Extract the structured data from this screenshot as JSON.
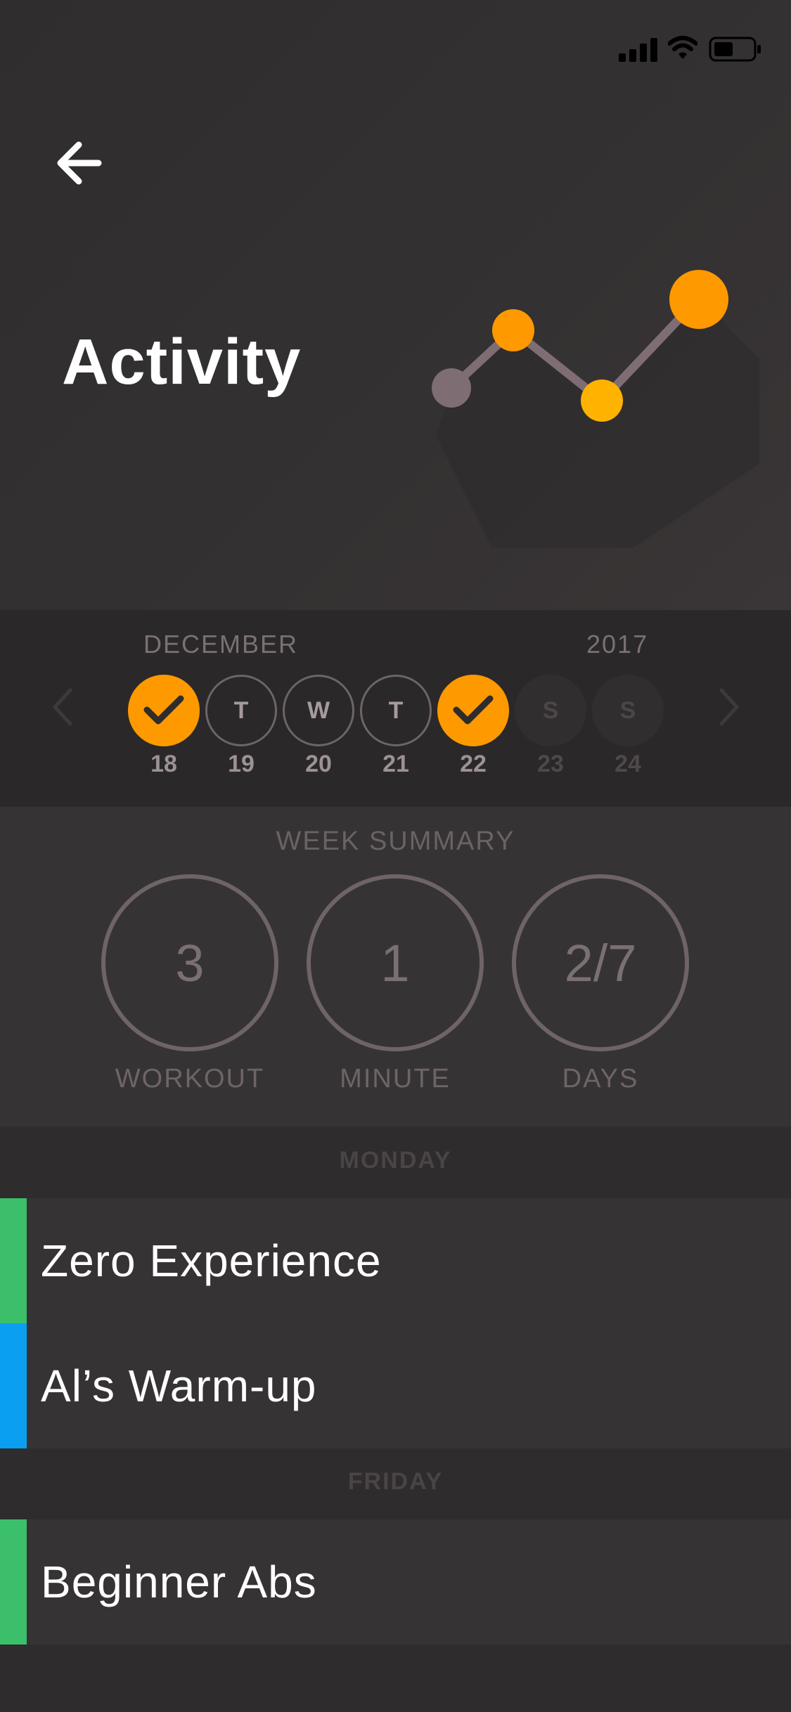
{
  "header": {
    "title": "Activity",
    "icons": [
      "back-arrow-icon",
      "signal-icon",
      "wifi-icon",
      "battery-icon",
      "activity-graph-icon"
    ]
  },
  "week_picker": {
    "month": "DECEMBER",
    "year": "2017",
    "days": [
      {
        "letter": "",
        "date": "18",
        "state": "done"
      },
      {
        "letter": "T",
        "date": "19",
        "state": "open"
      },
      {
        "letter": "W",
        "date": "20",
        "state": "open"
      },
      {
        "letter": "T",
        "date": "21",
        "state": "open"
      },
      {
        "letter": "",
        "date": "22",
        "state": "done"
      },
      {
        "letter": "S",
        "date": "23",
        "state": "future"
      },
      {
        "letter": "S",
        "date": "24",
        "state": "future"
      }
    ]
  },
  "summary": {
    "title": "WEEK SUMMARY",
    "stats": [
      {
        "value": "3",
        "label": "WORKOUT"
      },
      {
        "value": "1",
        "label": "MINUTE"
      },
      {
        "value": "2/7",
        "label": "DAYS"
      }
    ]
  },
  "sections": [
    {
      "day": "MONDAY",
      "items": [
        {
          "name": "Zero Experience",
          "color": "#3cbf6a"
        },
        {
          "name": "Al’s Warm-up",
          "color": "#0a9ff0"
        }
      ]
    },
    {
      "day": "FRIDAY",
      "items": [
        {
          "name": "Beginner Abs",
          "color": "#3cbf6a"
        }
      ]
    }
  ],
  "colors": {
    "accent": "#ff9900",
    "accent_light": "#ffb300",
    "muted": "#6e6466"
  }
}
